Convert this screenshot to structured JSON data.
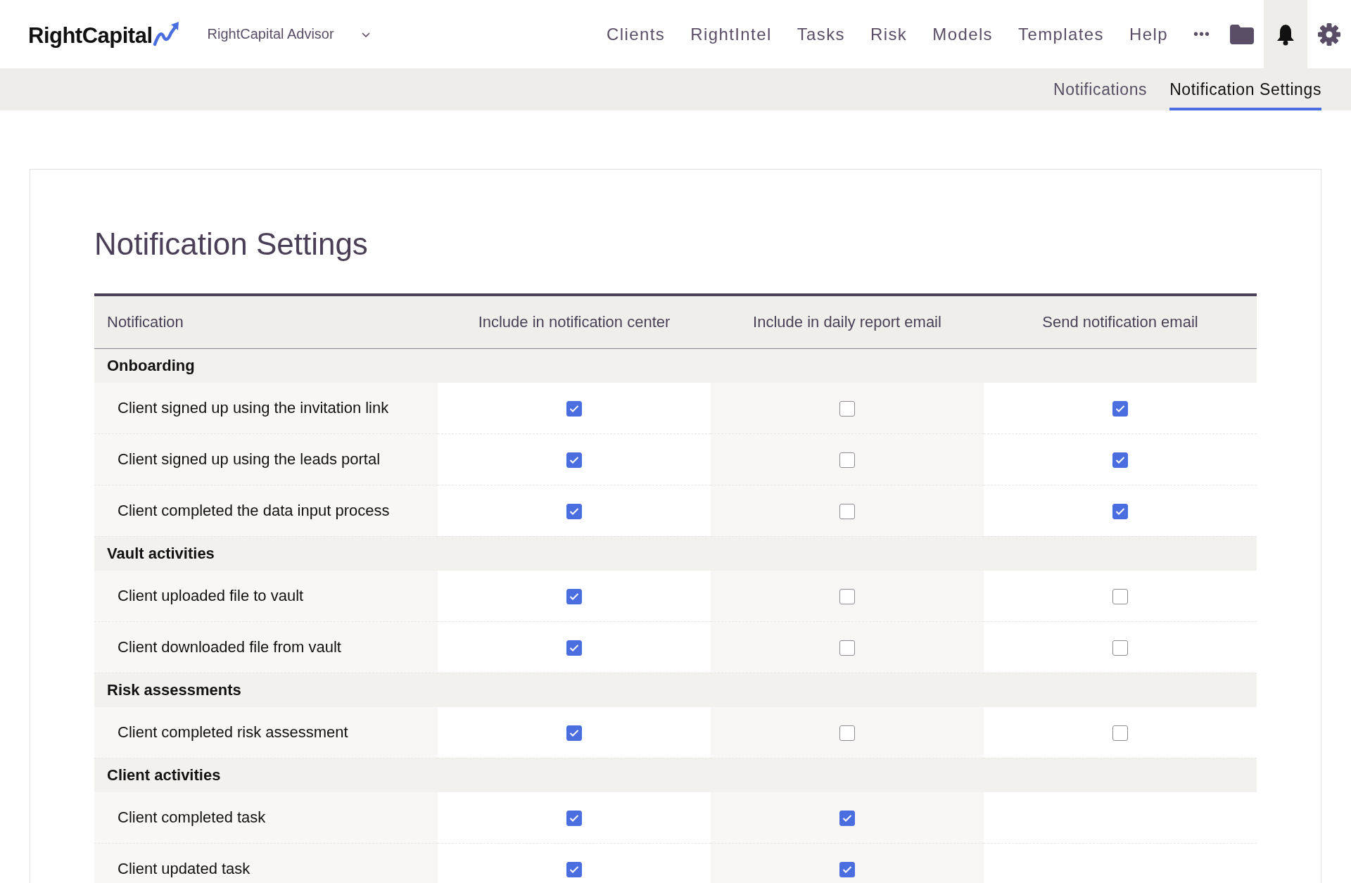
{
  "brand": {
    "logo": "RightCapital",
    "account": "RightCapital Advisor"
  },
  "nav": {
    "items": [
      "Clients",
      "RightIntel",
      "Tasks",
      "Risk",
      "Models",
      "Templates",
      "Help"
    ],
    "more": "•••"
  },
  "subnav": [
    {
      "label": "Notifications",
      "selected": false
    },
    {
      "label": "Notification Settings",
      "selected": true
    }
  ],
  "page_title": "Notification Settings",
  "table": {
    "columns": [
      "Notification",
      "Include in notification center",
      "Include in daily report email",
      "Send notification email"
    ],
    "groups": [
      {
        "name": "Onboarding",
        "rows": [
          {
            "label": "Client signed up using the invitation link",
            "checks": [
              true,
              false,
              true
            ]
          },
          {
            "label": "Client signed up using the leads portal",
            "checks": [
              true,
              false,
              true
            ]
          },
          {
            "label": "Client completed the data input process",
            "checks": [
              true,
              false,
              true
            ]
          }
        ]
      },
      {
        "name": "Vault activities",
        "rows": [
          {
            "label": "Client uploaded file to vault",
            "checks": [
              true,
              false,
              false
            ]
          },
          {
            "label": "Client downloaded file from vault",
            "checks": [
              true,
              false,
              false
            ]
          }
        ]
      },
      {
        "name": "Risk assessments",
        "rows": [
          {
            "label": "Client completed risk assessment",
            "checks": [
              true,
              false,
              false
            ]
          }
        ]
      },
      {
        "name": "Client activities",
        "rows": [
          {
            "label": "Client completed task",
            "checks": [
              true,
              true
            ]
          },
          {
            "label": "Client updated task",
            "checks": [
              true,
              true
            ]
          }
        ]
      }
    ]
  }
}
